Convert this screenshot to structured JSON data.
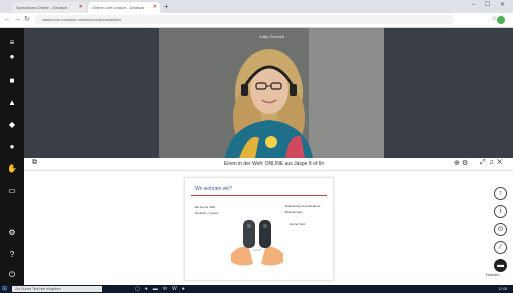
{
  "browser": {
    "tabs": [
      {
        "label": "Sprachkurs Online - Deutsch"
      },
      {
        "label": "Online Live Lesson - Deutsch"
      }
    ],
    "new_tab": "+",
    "url": "classroom.example.com/lesson/presentation",
    "window_buttons": "– ☐ ✕"
  },
  "video": {
    "speaker_name": "Katja Schmidt"
  },
  "presentation": {
    "title": "Einen in der Welt: ONLINE aus Jaspe 8 of 6h",
    "slide": {
      "title": "Wo wohnen wir?",
      "left_lines": [
        "Ein kurzer Satz",
        "Deutsch – Lernen"
      ],
      "right_lines": [
        "Entdeckung verschiedener",
        "Bedeutungen",
        "Ein kurzer Satz"
      ]
    }
  },
  "rail": {
    "note": "Notizen"
  },
  "taskbar": {
    "search_placeholder": "Zur Suche Text hier eingeben",
    "tray_time": "12:08"
  },
  "colors": {
    "accent_blue": "#3a5aa8",
    "accent_red": "#c24a2d",
    "sidebar_bg": "#141414",
    "video_bg": "#3a3f47"
  }
}
